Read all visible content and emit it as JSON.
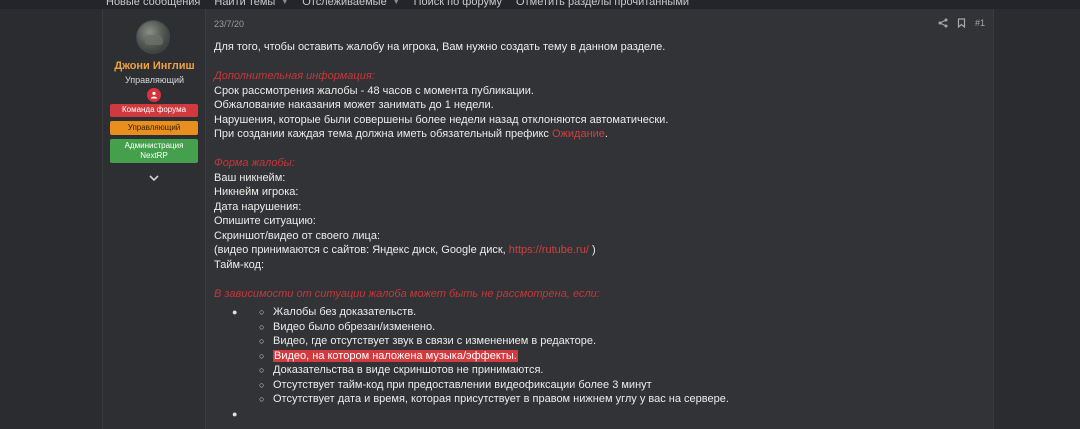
{
  "nav": {
    "items": [
      {
        "label": "Новые сообщения",
        "has_caret": false
      },
      {
        "label": "Найти темы",
        "has_caret": true
      },
      {
        "label": "Отслеживаемые",
        "has_caret": true
      },
      {
        "label": "Поиск по форуму",
        "has_caret": false
      },
      {
        "label": "Отметить разделы прочитанными",
        "has_caret": false
      }
    ]
  },
  "user": {
    "name": "Джони Инглиш",
    "title": "Управляющий",
    "banners": [
      "Команда форума",
      "Управляющий",
      "Администрация NextRP"
    ],
    "colors": {
      "name": "#f0a23a",
      "banner_red": "#d03a3e",
      "banner_orange": "#e98f1e",
      "banner_green": "#45a04d"
    }
  },
  "post": {
    "date": "23/7/20",
    "number": "#1",
    "icons": [
      "share-icon",
      "bookmark-icon"
    ],
    "intro": "Для того, чтобы оставить жалобу на игрока, Вам нужно создать тему в данном разделе.",
    "info_heading": "Дополнительная информация:",
    "info_lines": [
      "Срок рассмотрения жалобы - 48 часов с момента публикации.",
      "Обжалование наказания может занимать до 1 недели.",
      "Нарушения, которые были совершены более недели назад отклоняются автоматически."
    ],
    "prefix_text": "При создании каждая тема должна иметь обязательный префикс ",
    "prefix_word": "Ожидание",
    "prefix_end": ".",
    "form_heading": "Форма жалобы:",
    "form_lines": [
      "Ваш никнейм:",
      "Никнейм игрока:",
      "Дата нарушения:",
      "Опишите ситуацию:",
      "Скриншот/видео от своего лица:"
    ],
    "video_prefix": "(видео принимаются с сайтов: Яндекс диск, Google диск, ",
    "video_link": "https://rutube.ru/",
    "video_suffix": " )",
    "timecode": "Тайм-код:",
    "reject_heading": "В зависимости от ситуации жалоба может быть не рассмотрена, если:",
    "reject_items": [
      "Жалобы без доказательств.",
      "Видео было обрезан/изменено.",
      "Видео, где отсутствует звук в связи с изменением в редакторе.",
      "Видео, на котором наложена музыка/эффекты.",
      "Доказательства в виде скриншотов не принимаются.",
      "Отсутствует тайм-код при предоставлении видеофиксации более 3 минут",
      "Отсутствует дата и время, которая присутствует в правом нижнем углу у вас на сервере."
    ],
    "highlighted_index": 3,
    "accent_color": "#d23f3f"
  }
}
